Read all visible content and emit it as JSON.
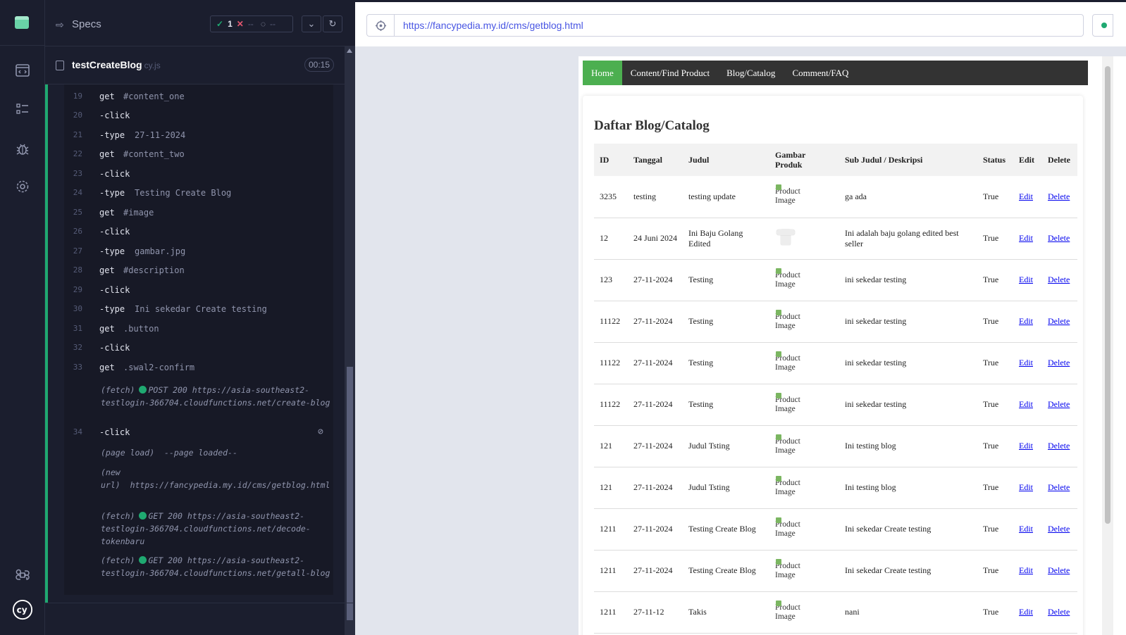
{
  "reporter": {
    "specs_label": "Specs",
    "stats": {
      "passed": "1",
      "failed": "--",
      "pending": "--"
    },
    "spec_file": {
      "name": "testCreateBlog",
      "ext": "cy.js",
      "duration": "00:15"
    },
    "commands": [
      {
        "num": "19",
        "name": "get",
        "arg": "#content_one",
        "child": false
      },
      {
        "num": "20",
        "name": "-click",
        "arg": "",
        "child": true
      },
      {
        "num": "21",
        "name": "-type",
        "arg": "27-11-2024",
        "child": true
      },
      {
        "num": "22",
        "name": "get",
        "arg": "#content_two",
        "child": false
      },
      {
        "num": "23",
        "name": "-click",
        "arg": "",
        "child": true
      },
      {
        "num": "24",
        "name": "-type",
        "arg": "Testing Create Blog",
        "child": true
      },
      {
        "num": "25",
        "name": "get",
        "arg": "#image",
        "child": false
      },
      {
        "num": "26",
        "name": "-click",
        "arg": "",
        "child": true
      },
      {
        "num": "27",
        "name": "-type",
        "arg": "gambar.jpg",
        "child": true
      },
      {
        "num": "28",
        "name": "get",
        "arg": "#description",
        "child": false
      },
      {
        "num": "29",
        "name": "-click",
        "arg": "",
        "child": true
      },
      {
        "num": "30",
        "name": "-type",
        "arg": "Ini sekedar Create testing",
        "child": true
      },
      {
        "num": "31",
        "name": "get",
        "arg": ".button",
        "child": false
      },
      {
        "num": "32",
        "name": "-click",
        "arg": "",
        "child": true
      },
      {
        "num": "33",
        "name": "get",
        "arg": ".swal2-confirm",
        "child": false
      }
    ],
    "log_fetch_1": {
      "prefix": "(fetch)",
      "method": "POST 200",
      "url": "https://asia-southeast2-testlogin-366704.cloudfunctions.net/create-blog"
    },
    "cmd_34": {
      "num": "34",
      "name": "-click"
    },
    "log_page_load": {
      "prefix": "(page load)",
      "text": "--page loaded--"
    },
    "log_new_url": {
      "prefix": "(new url)",
      "url": "https://fancypedia.my.id/cms/getblog.html"
    },
    "log_fetch_2": {
      "prefix": "(fetch)",
      "method": "GET 200",
      "url": "https://asia-southeast2-testlogin-366704.cloudfunctions.net/decode-tokenbaru"
    },
    "log_fetch_3": {
      "prefix": "(fetch)",
      "method": "GET 200",
      "url": "https://asia-southeast2-testlogin-366704.cloudfunctions.net/getall-blog"
    }
  },
  "aut": {
    "url": "https://fancypedia.my.id/cms/getblog.html",
    "nav": [
      "Home",
      "Content/Find Product",
      "Blog/Catalog",
      "Comment/FAQ"
    ],
    "heading": "Daftar Blog/Catalog",
    "columns": [
      "ID",
      "Tanggal",
      "Judul",
      "Gambar Produk",
      "Sub Judul / Deskripsi",
      "Status",
      "Edit",
      "Delete"
    ],
    "image_alt": "Product Image",
    "rows": [
      {
        "id": "3235",
        "date": "testing",
        "title": "testing update",
        "image": "broken",
        "desc": "ga ada",
        "status": "True",
        "edit": "Edit",
        "delete": "Delete"
      },
      {
        "id": "12",
        "date": "24 Juni 2024",
        "title": "Ini Baju Golang Edited",
        "image": "shirt",
        "desc": "Ini adalah baju golang edited best seller",
        "status": "True",
        "edit": "Edit",
        "delete": "Delete"
      },
      {
        "id": "123",
        "date": "27-11-2024",
        "title": "Testing",
        "image": "broken",
        "desc": "ini sekedar testing",
        "status": "True",
        "edit": "Edit",
        "delete": "Delete"
      },
      {
        "id": "11122",
        "date": "27-11-2024",
        "title": "Testing",
        "image": "broken",
        "desc": "ini sekedar testing",
        "status": "True",
        "edit": "Edit",
        "delete": "Delete"
      },
      {
        "id": "11122",
        "date": "27-11-2024",
        "title": "Testing",
        "image": "broken",
        "desc": "ini sekedar testing",
        "status": "True",
        "edit": "Edit",
        "delete": "Delete"
      },
      {
        "id": "11122",
        "date": "27-11-2024",
        "title": "Testing",
        "image": "broken",
        "desc": "ini sekedar testing",
        "status": "True",
        "edit": "Edit",
        "delete": "Delete"
      },
      {
        "id": "121",
        "date": "27-11-2024",
        "title": "Judul Tsting",
        "image": "broken",
        "desc": "Ini testing blog",
        "status": "True",
        "edit": "Edit",
        "delete": "Delete"
      },
      {
        "id": "121",
        "date": "27-11-2024",
        "title": "Judul Tsting",
        "image": "broken",
        "desc": "Ini testing blog",
        "status": "True",
        "edit": "Edit",
        "delete": "Delete"
      },
      {
        "id": "1211",
        "date": "27-11-2024",
        "title": "Testing Create Blog",
        "image": "broken",
        "desc": "Ini sekedar Create testing",
        "status": "True",
        "edit": "Edit",
        "delete": "Delete"
      },
      {
        "id": "1211",
        "date": "27-11-2024",
        "title": "Testing Create Blog",
        "image": "broken",
        "desc": "Ini sekedar Create testing",
        "status": "True",
        "edit": "Edit",
        "delete": "Delete"
      },
      {
        "id": "1211",
        "date": "27-11-12",
        "title": "Takis",
        "image": "broken",
        "desc": "nani",
        "status": "True",
        "edit": "Edit",
        "delete": "Delete"
      }
    ]
  },
  "colors": {
    "pass": "#1fa971",
    "fail": "#e45770",
    "nav_active": "#4caf50",
    "nav_bg": "#333333",
    "url": "#4956e3"
  },
  "icons": [
    "app-logo-icon",
    "runs-icon",
    "specs-list-icon",
    "debug-icon",
    "settings-icon",
    "shortcuts-icon",
    "cypress-logo-icon",
    "hide-icon",
    "selector-playground-icon",
    "refresh-icon",
    "chevron-down-icon"
  ]
}
